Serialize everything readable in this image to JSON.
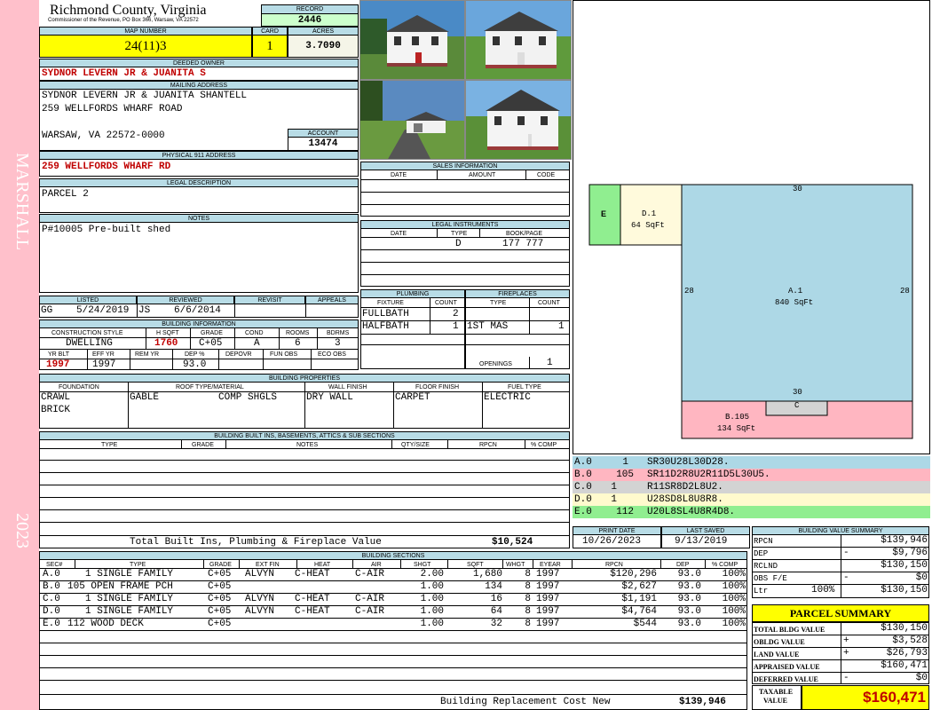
{
  "sidebar": {
    "district": "MARSHALL",
    "year": "2023"
  },
  "header": {
    "county": "Richmond County, Virginia",
    "commissioner": "Commissioner of the Revenue, PO Box 366, Warsaw, VA 22572",
    "record_label": "RECORD",
    "record": "2446"
  },
  "map": {
    "map_label": "MAP NUMBER",
    "map_number": "24(11)3",
    "card_label": "CARD",
    "card": "1",
    "acres_label": "ACRES",
    "acres": "3.7090"
  },
  "owner": {
    "label": "DEEDED OWNER",
    "name": "SYDNOR LEVERN JR & JUANITA S"
  },
  "mailing": {
    "label": "MAILING ADDRESS",
    "line1": "SYDNOR LEVERN JR & JUANITA SHANTELL",
    "line2": "259 WELLFORDS WHARF ROAD",
    "line3": "WARSAW, VA 22572-0000",
    "account_label": "ACCOUNT",
    "account": "13474"
  },
  "physical": {
    "label": "PHYSICAL 911 ADDRESS",
    "address": "259 WELLFORDS WHARF RD"
  },
  "legal": {
    "label": "LEGAL DESCRIPTION",
    "text": "PARCEL 2"
  },
  "notes": {
    "label": "NOTES",
    "text": "P#10005 Pre-built shed"
  },
  "sales": {
    "label": "SALES INFORMATION",
    "cols": [
      "DATE",
      "AMOUNT",
      "CODE"
    ]
  },
  "instruments": {
    "label": "LEGAL INSTRUMENTS",
    "cols": [
      "DATE",
      "TYPE",
      "BOOK/PAGE"
    ],
    "type": "D",
    "bookpage": "177 777"
  },
  "listed": {
    "listed_label": "LISTED",
    "listed_by": "GG",
    "listed_date": "5/24/2019",
    "reviewed_label": "REVIEWED",
    "reviewed_by": "JS",
    "reviewed_date": "6/6/2014",
    "revisit_label": "REVISIT",
    "appeals_label": "APPEALS"
  },
  "plumbing": {
    "label": "PLUMBING",
    "fixture_label": "FIXTURE",
    "count_label": "COUNT",
    "rows": [
      {
        "fixture": "FULLBATH",
        "count": "2"
      },
      {
        "fixture": "HALFBATH",
        "count": "1"
      }
    ]
  },
  "fireplaces": {
    "label": "FIREPLACES",
    "type_label": "TYPE",
    "count_label": "COUNT",
    "type": "1ST MAS",
    "count": "1",
    "openings_label": "OPENINGS",
    "openings": "1"
  },
  "building": {
    "label": "BUILDING INFORMATION",
    "cs_label": "CONSTRUCTION STYLE",
    "hsqft_label": "H SQFT",
    "grade_label": "GRADE",
    "cond_label": "COND",
    "rooms_label": "ROOMS",
    "bdrms_label": "BDRMS",
    "style": "DWELLING",
    "hsqft": "1760",
    "grade": "C+05",
    "cond": "A",
    "rooms": "6",
    "bdrms": "3",
    "yrblt_label": "YR BLT",
    "effyr_label": "EFF YR",
    "remyr_label": "REM YR",
    "dep_label": "DEP %",
    "depovr_label": "DEPOVR",
    "funobs_label": "FUN OBS",
    "ecoobs_label": "ECO OBS",
    "yrblt": "1997",
    "effyr": "1997",
    "dep": "93.0"
  },
  "properties": {
    "label": "BUILDING PROPERTIES",
    "foundation_label": "FOUNDATION",
    "roof_label": "ROOF TYPE/MATERIAL",
    "wall_label": "WALL FINISH",
    "floor_label": "FLOOR FINISH",
    "fuel_label": "FUEL TYPE",
    "foundation1": "CRAWL",
    "foundation2": "BRICK",
    "roof_type": "GABLE",
    "roof_mat": "COMP SHGLS",
    "wall": "DRY WALL",
    "floor": "CARPET",
    "fuel": "ELECTRIC"
  },
  "builtins": {
    "label": "BUILDING BUILT INS, BASEMENTS, ATTICS & SUB SECTIONS",
    "cols": [
      "TYPE",
      "GRADE",
      "NOTES",
      "QTY/SIZE",
      "RPCN",
      "% COMP"
    ],
    "total_label": "Total Built Ins, Plumbing & Fireplace Value",
    "total": "$10,524"
  },
  "print": {
    "print_label": "PRINT DATE",
    "print_date": "10/26/2023",
    "saved_label": "LAST SAVED",
    "saved_date": "9/13/2019"
  },
  "sketch": {
    "sections": [
      {
        "code": "E",
        "label": "E"
      },
      {
        "code": "D.1",
        "label": "D.1",
        "area": "64 SqFt"
      },
      {
        "code": "A.1",
        "label": "A.1",
        "area": "840 SqFt"
      },
      {
        "code": "B.105",
        "label": "B.105",
        "area": "134 SqFt"
      },
      {
        "code": "C",
        "label": "C"
      }
    ],
    "dims": {
      "top": "30",
      "left": "28",
      "right": "28",
      "mid": "30"
    }
  },
  "vectors": [
    {
      "sec": "A.0",
      "code": "1",
      "vec": "SR30U28L30D28.",
      "color": "#add8e6"
    },
    {
      "sec": "B.0",
      "code": "105",
      "vec": "SR11D2R8U2R11D5L30U5.",
      "color": "#ffb6c1"
    },
    {
      "sec": "C.0",
      "code": "1",
      "vec": "R11SR8D2L8U2.",
      "color": "#d3d3d3"
    },
    {
      "sec": "D.0",
      "code": "1",
      "vec": "U28SD8L8U8R8.",
      "color": "#fffacd"
    },
    {
      "sec": "E.0",
      "code": "112",
      "vec": "U20L8SL4U8R4D8.",
      "color": "#90ee90"
    }
  ],
  "bvs": {
    "label": "BUILDING VALUE SUMMARY",
    "rows": [
      {
        "label": "RPCN",
        "sign": "",
        "value": "$139,946"
      },
      {
        "label": "DEP",
        "sign": "-",
        "value": "$9,796"
      },
      {
        "label": "RCLND",
        "sign": "",
        "value": "$130,150"
      },
      {
        "label": "OBS F/E",
        "sign": "-",
        "value": "$0"
      },
      {
        "label": "Ltr",
        "pct": "100%",
        "sign": "",
        "value": "$130,150"
      }
    ]
  },
  "sections": {
    "label": "BUILDING SECTIONS",
    "cols": [
      "SEC#",
      "TYPE",
      "GRADE",
      "EXT FIN",
      "HEAT",
      "AIR",
      "SHGT",
      "SQFT",
      "WHGT",
      "EYEAR",
      "RPCN",
      "DEP",
      "% COMP"
    ],
    "rows": [
      {
        "sec": "A.0",
        "type": "1 SINGLE FAMILY",
        "grade": "C+05",
        "ext": "ALVYN",
        "heat": "C-HEAT",
        "air": "C-AIR",
        "shgt": "2.00",
        "sqft": "1,680",
        "whgt": "8",
        "eyear": "1997",
        "rpcn": "$120,296",
        "dep": "93.0",
        "comp": "100%"
      },
      {
        "sec": "B.0",
        "type": "105 OPEN FRAME PCH",
        "grade": "C+05",
        "ext": "",
        "heat": "",
        "air": "",
        "shgt": "1.00",
        "sqft": "134",
        "whgt": "8",
        "eyear": "1997",
        "rpcn": "$2,627",
        "dep": "93.0",
        "comp": "100%"
      },
      {
        "sec": "C.0",
        "type": "1 SINGLE FAMILY",
        "grade": "C+05",
        "ext": "ALVYN",
        "heat": "C-HEAT",
        "air": "C-AIR",
        "shgt": "1.00",
        "sqft": "16",
        "whgt": "8",
        "eyear": "1997",
        "rpcn": "$1,191",
        "dep": "93.0",
        "comp": "100%"
      },
      {
        "sec": "D.0",
        "type": "1 SINGLE FAMILY",
        "grade": "C+05",
        "ext": "ALVYN",
        "heat": "C-HEAT",
        "air": "C-AIR",
        "shgt": "1.00",
        "sqft": "64",
        "whgt": "8",
        "eyear": "1997",
        "rpcn": "$4,764",
        "dep": "93.0",
        "comp": "100%"
      },
      {
        "sec": "E.0",
        "type": "112 WOOD DECK",
        "grade": "C+05",
        "ext": "",
        "heat": "",
        "air": "",
        "shgt": "1.00",
        "sqft": "32",
        "whgt": "8",
        "eyear": "1997",
        "rpcn": "$544",
        "dep": "93.0",
        "comp": "100%"
      }
    ],
    "rcn_label": "Building Replacement Cost New",
    "rcn": "$139,946"
  },
  "parcel": {
    "label": "PARCEL SUMMARY",
    "rows": [
      {
        "label": "TOTAL BLDG VALUE",
        "sign": "",
        "value": "$130,150"
      },
      {
        "label": "OBLDG VALUE",
        "sign": "+",
        "value": "$3,528"
      },
      {
        "label": "LAND VALUE",
        "sign": "+",
        "value": "$26,793"
      },
      {
        "label": "APPRAISED VALUE",
        "sign": "",
        "value": "$160,471"
      },
      {
        "label": "DEFERRED VALUE",
        "sign": "-",
        "value": "$0"
      }
    ],
    "taxable_label1": "TAXABLE",
    "taxable_label2": "VALUE",
    "taxable": "$160,471"
  }
}
